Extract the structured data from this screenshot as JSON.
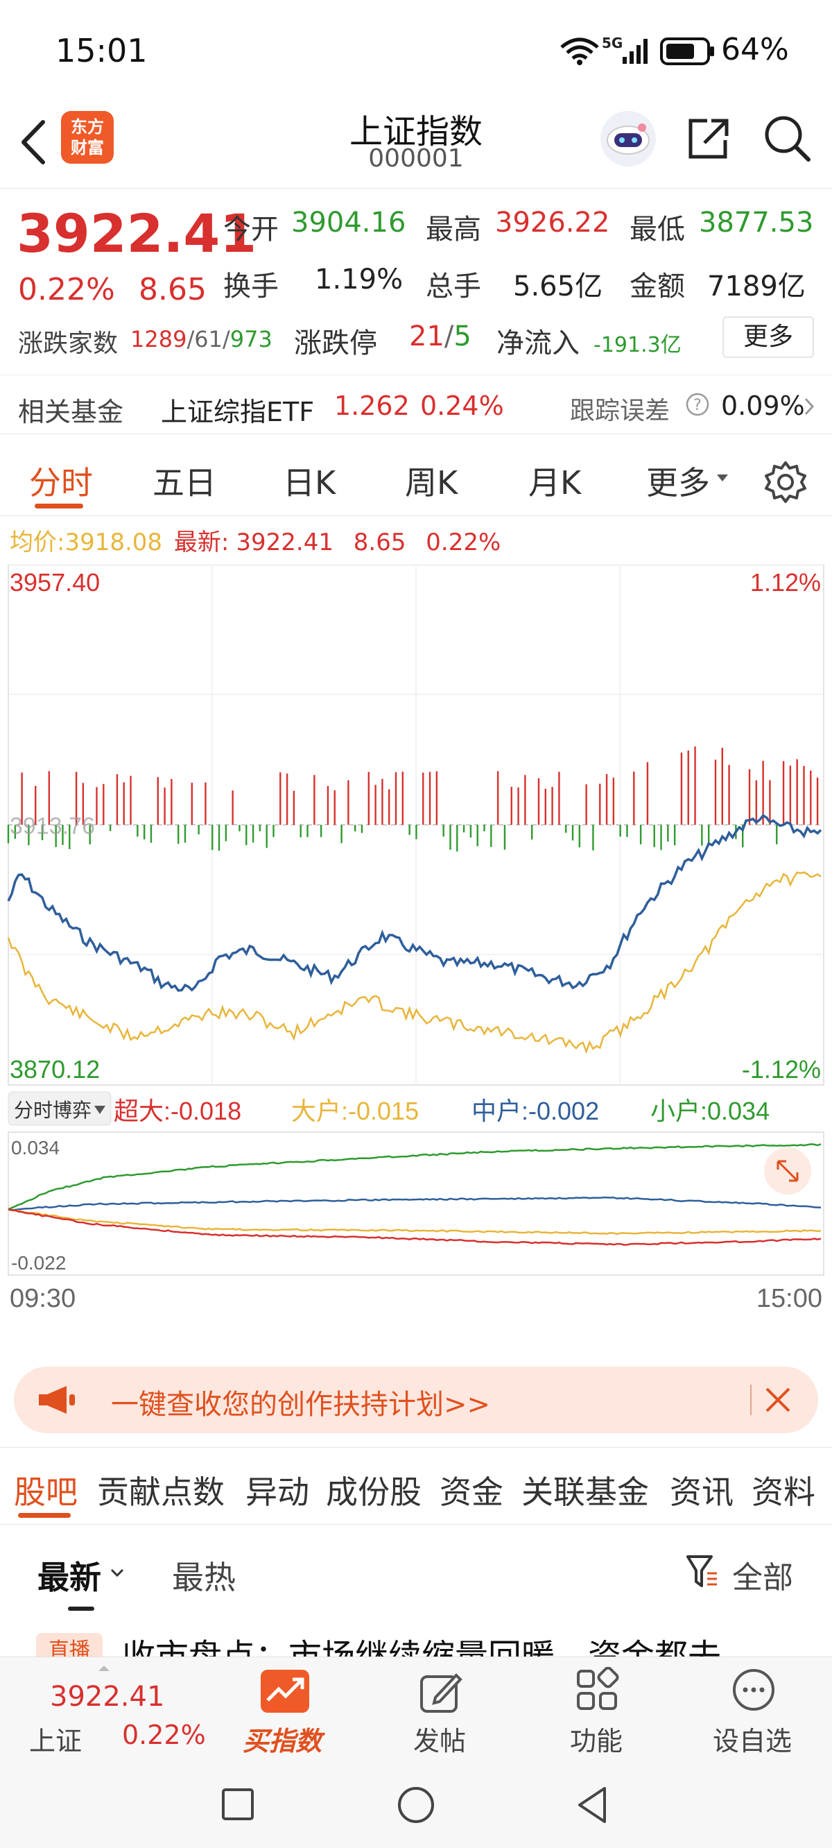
{
  "status": {
    "time": "15:01",
    "network": "5G",
    "battery": "64%"
  },
  "header": {
    "title": "上证指数",
    "code": "000001",
    "logo_line1": "东方",
    "logo_line2": "财富"
  },
  "quote": {
    "price": "3922.41",
    "change_pct": "0.22%",
    "change": "8.65",
    "open_label": "今开",
    "open": "3904.16",
    "high_label": "最高",
    "high": "3926.22",
    "low_label": "最低",
    "low": "3877.53",
    "turnover_label": "换手",
    "turnover": "1.19%",
    "volume_label": "总手",
    "volume": "5.65亿",
    "amount_label": "金额",
    "amount": "7189亿",
    "breadth_label": "涨跌家数",
    "up": "1289",
    "flat": "61",
    "down": "973",
    "sep": "/",
    "limit_label": "涨跌停",
    "limit_up": "21",
    "limit_down": "5",
    "inflow_label": "净流入",
    "inflow": "-191.3亿",
    "more": "更多"
  },
  "fund": {
    "label": "相关基金",
    "name": "上证综指ETF",
    "price": "1.262",
    "pct": "0.24%",
    "track_label": "跟踪误差",
    "track": "0.09%"
  },
  "tabs": [
    "分时",
    "五日",
    "日K",
    "周K",
    "月K",
    "更多"
  ],
  "chart": {
    "avg_label": "均价:",
    "avg": "3918.08",
    "latest_label": "最新:",
    "latest": "3922.41",
    "latest_chg": "8.65",
    "latest_pct": "0.22%",
    "y_top": "3957.40",
    "y_top_pct": "1.12%",
    "y_bottom": "3870.12",
    "y_bottom_pct": "-1.12%",
    "y_mid": "3913.76",
    "time_start": "09:30",
    "time_end": "15:00"
  },
  "flow": {
    "selector": "分时博弈",
    "super_label": "超大:",
    "super": "-0.018",
    "large_label": "大户:",
    "large": "-0.015",
    "mid_label": "中户:",
    "mid": "-0.002",
    "small_label": "小户:",
    "small": "0.034",
    "y_top": "0.034",
    "y_bottom": "-0.022"
  },
  "colors": {
    "up": "#d8302e",
    "down": "#2e9a2e",
    "avg": "#e8b53a",
    "price": "#2f5e9b",
    "brand": "#f05a28"
  },
  "banner": {
    "text": "一键查收您的创作扶持计划>>"
  },
  "subtabs": [
    "股吧",
    "贡献点数",
    "异动",
    "成份股",
    "资金",
    "关联基金",
    "资讯",
    "资料"
  ],
  "feed": {
    "sort_new": "最新",
    "sort_hot": "最热",
    "filter": "全部",
    "badge": "直播",
    "headline": "收市盘点：市场继续缩量回暖，资金都去"
  },
  "bottom": {
    "price": "3922.41",
    "name": "上证",
    "pct": "0.22%",
    "buy": "买指数",
    "post": "发帖",
    "func": "功能",
    "fav": "设自选"
  }
}
